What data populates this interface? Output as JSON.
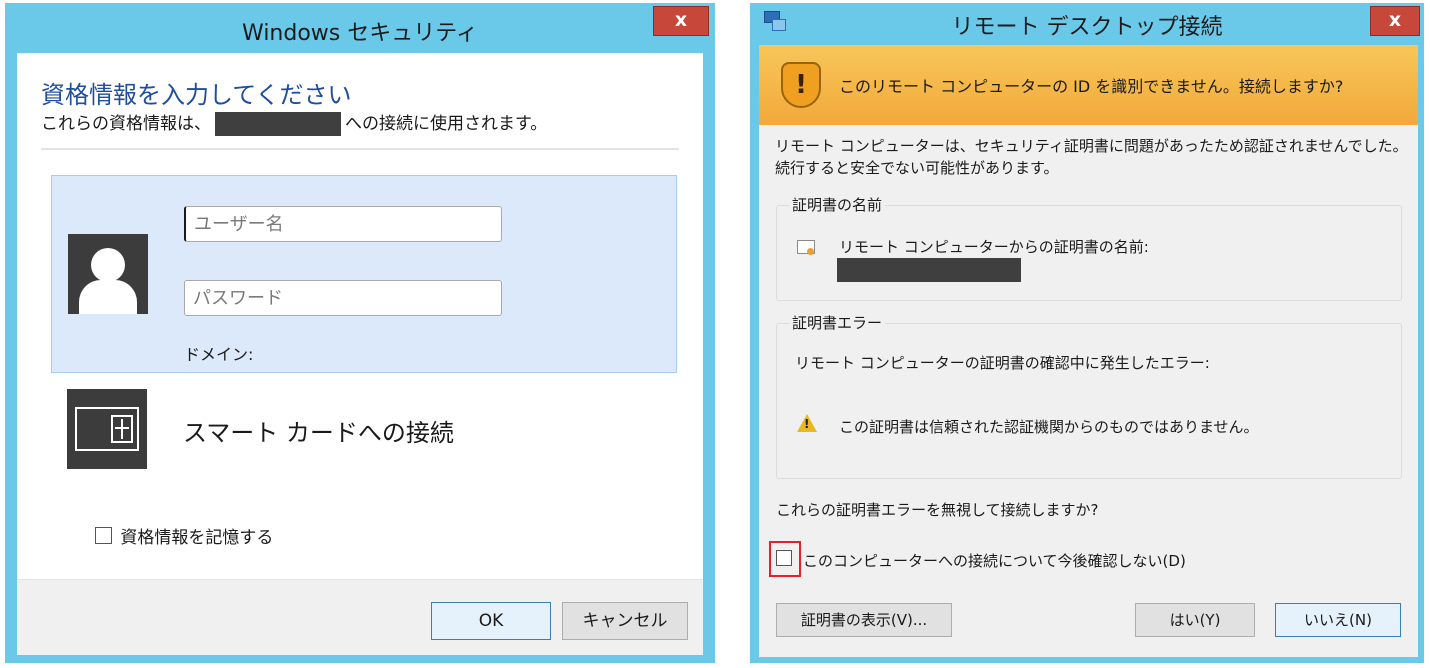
{
  "security_dialog": {
    "title": "Windows セキュリティ",
    "close_label": "x",
    "heading": "資格情報を入力してください",
    "subtext_before": "これらの資格情報は、",
    "subtext_after": "への接続に使用されます。",
    "username_placeholder": "ユーザー名",
    "password_placeholder": "パスワード",
    "domain_label": "ドメイン:",
    "smartcard_label": "スマート カードへの接続",
    "remember_label": "資格情報を記憶する",
    "remember_checked": false,
    "ok_label": "OK",
    "cancel_label": "キャンセル"
  },
  "rdp_dialog": {
    "title": "リモート デスクトップ接続",
    "close_label": "x",
    "banner_icon": "!",
    "banner_text": "このリモート コンピューターの ID を識別できません。接続しますか?",
    "description": "リモート コンピューターは、セキュリティ証明書に問題があったため認証されませんでした。続行すると安全でない可能性があります。",
    "cert_name_group_title": "証明書の名前",
    "cert_name_label": "リモート コンピューターからの証明書の名前:",
    "cert_error_group_title": "証明書エラー",
    "cert_error_label": "リモート コンピューターの証明書の確認中に発生したエラー:",
    "warning_icon": "!",
    "cert_error_text": "この証明書は信頼された認証機関からのものではありません。",
    "ignore_question": "これらの証明書エラーを無視して接続しますか?",
    "dont_ask_label": "このコンピューターへの接続について今後確認しない(D)",
    "dont_ask_checked": false,
    "view_cert_label": "証明書の表示(V)...",
    "yes_label": "はい(Y)",
    "no_label": "いいえ(N)"
  },
  "colors": {
    "window_frame": "#6ac9e9",
    "close_button": "#c7473b",
    "heading_blue": "#1e4e9c",
    "credential_tile": "#dbe9fa",
    "warning_banner": "#f2a93a",
    "highlight_red": "#e4202a"
  },
  "icons": [
    "user-avatar-icon",
    "smart-card-icon",
    "remote-desktop-icon",
    "shield-warning-icon",
    "certificate-icon",
    "warning-triangle-icon"
  ]
}
